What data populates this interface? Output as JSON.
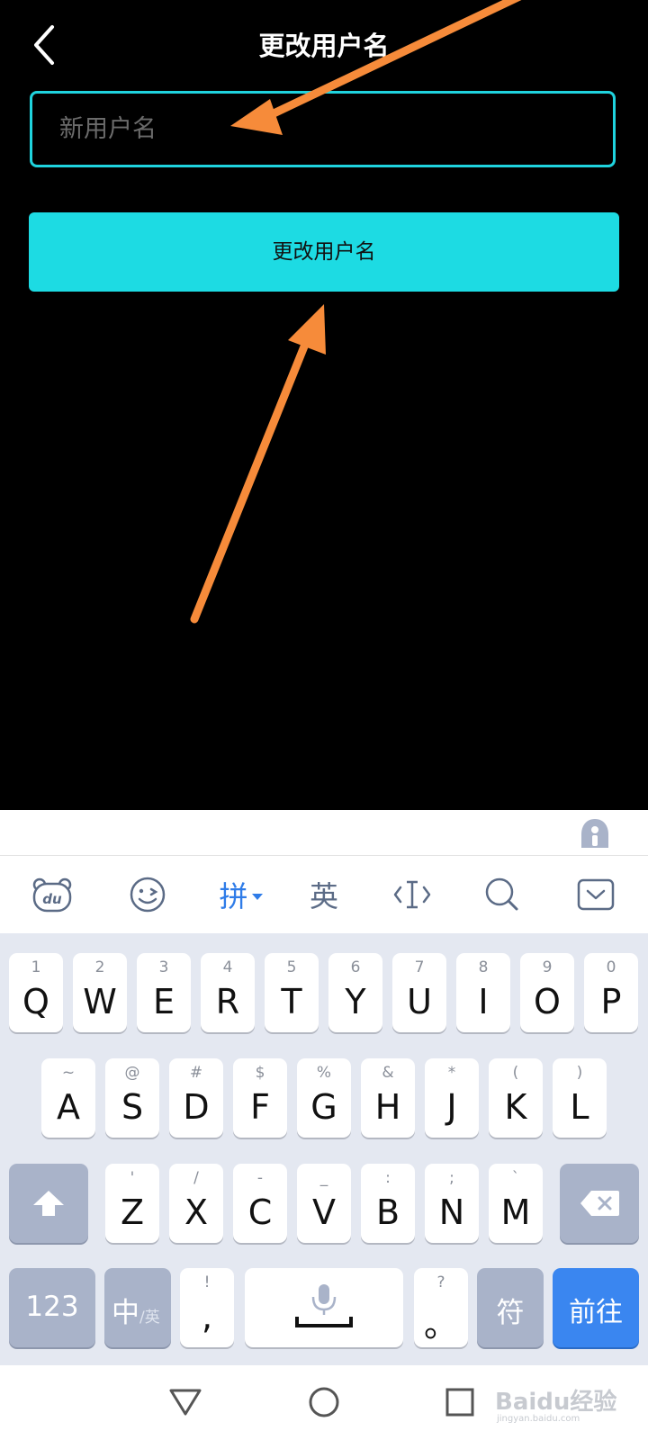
{
  "header": {
    "title": "更改用户名"
  },
  "form": {
    "input_placeholder": "新用户名",
    "submit_label": "更改用户名"
  },
  "keyboard": {
    "toolbar": {
      "pinyin_label": "拼",
      "english_label": "英"
    },
    "row1": [
      {
        "sub": "1",
        "main": "Q"
      },
      {
        "sub": "2",
        "main": "W"
      },
      {
        "sub": "3",
        "main": "E"
      },
      {
        "sub": "4",
        "main": "R"
      },
      {
        "sub": "5",
        "main": "T"
      },
      {
        "sub": "6",
        "main": "Y"
      },
      {
        "sub": "7",
        "main": "U"
      },
      {
        "sub": "8",
        "main": "I"
      },
      {
        "sub": "9",
        "main": "O"
      },
      {
        "sub": "0",
        "main": "P"
      }
    ],
    "row2": [
      {
        "sub": "~",
        "main": "A"
      },
      {
        "sub": "@",
        "main": "S"
      },
      {
        "sub": "#",
        "main": "D"
      },
      {
        "sub": "$",
        "main": "F"
      },
      {
        "sub": "%",
        "main": "G"
      },
      {
        "sub": "&",
        "main": "H"
      },
      {
        "sub": "*",
        "main": "J"
      },
      {
        "sub": "(",
        "main": "K"
      },
      {
        "sub": ")",
        "main": "L"
      }
    ],
    "row3": [
      {
        "sub": "'",
        "main": "Z"
      },
      {
        "sub": "/",
        "main": "X"
      },
      {
        "sub": "-",
        "main": "C"
      },
      {
        "sub": "_",
        "main": "V"
      },
      {
        "sub": ":",
        "main": "B"
      },
      {
        "sub": ";",
        "main": "N"
      },
      {
        "sub": "`",
        "main": "M"
      }
    ],
    "bottom": {
      "numbers_label": "123",
      "chinese_label": "中",
      "english_small": "/英",
      "comma_sub": "!",
      "comma_main": ",",
      "period_sub": "?",
      "period_main": "。",
      "symbols_label": "符",
      "go_label": "前往"
    }
  },
  "watermark": {
    "text": "Baidu经验",
    "sub": "jingyan.baidu.com"
  },
  "colors": {
    "accent": "#1ddbe3",
    "arrow": "#f68b3a",
    "key_blue": "#3a86f0"
  }
}
